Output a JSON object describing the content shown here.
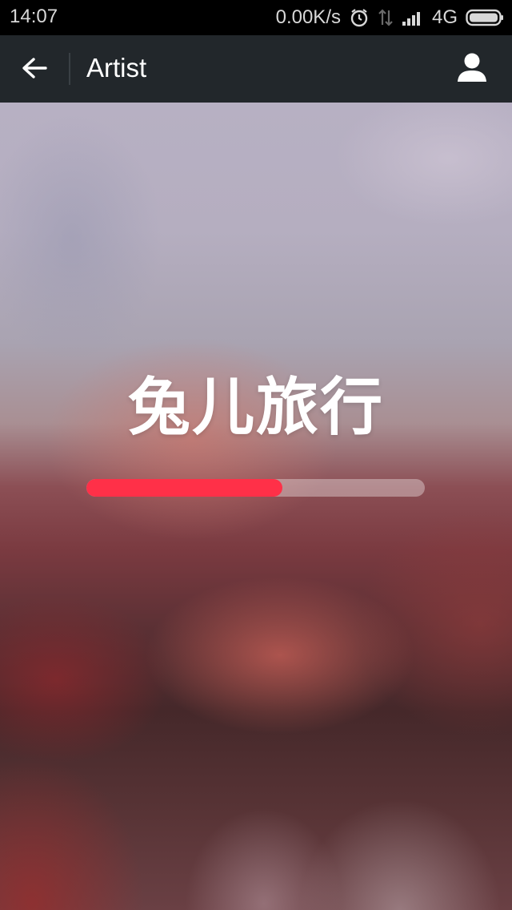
{
  "status_bar": {
    "time": "14:07",
    "net_speed": "0.00K/s",
    "network": "4G",
    "icons": [
      "alarm-icon",
      "data-transfer-icon",
      "signal-icon",
      "battery-icon"
    ]
  },
  "app_bar": {
    "title": "Artist",
    "back_icon": "arrow-left-icon",
    "profile_icon": "person-icon"
  },
  "hero": {
    "title": "兔儿旅行",
    "progress": 0.58
  },
  "colors": {
    "accent": "#ff3048",
    "app_bar": "#22272b",
    "status_bar": "#000000"
  }
}
